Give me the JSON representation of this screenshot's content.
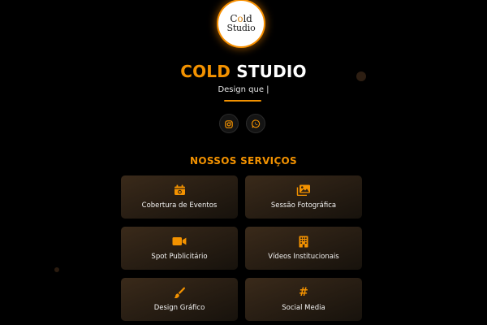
{
  "brand": {
    "logo_line1_pre": "C",
    "logo_line1_o": "o",
    "logo_line1_post": "ld",
    "logo_line2": "Studio",
    "title_accent": "COLD",
    "title_main": "STUDIO",
    "tagline": "Design que |"
  },
  "social": [
    {
      "name": "instagram",
      "icon": "instagram-icon"
    },
    {
      "name": "whatsapp",
      "icon": "whatsapp-icon"
    }
  ],
  "services": {
    "heading": "NOSSOS SERVIÇOS",
    "items": [
      {
        "label": "Cobertura de Eventos",
        "icon": "calendar-camera-icon"
      },
      {
        "label": "Sessão Fotográfica",
        "icon": "images-icon"
      },
      {
        "label": "Spot Publicitário",
        "icon": "video-camera-icon"
      },
      {
        "label": "Vídeos Institucionais",
        "icon": "building-icon"
      },
      {
        "label": "Design Gráfico",
        "icon": "brush-icon"
      },
      {
        "label": "Social Media",
        "icon": "hashtag-icon",
        "glyph": "#"
      }
    ]
  },
  "colors": {
    "accent": "#f39200",
    "background": "#000000",
    "card": "#2a1f14",
    "text": "#ffffff"
  }
}
